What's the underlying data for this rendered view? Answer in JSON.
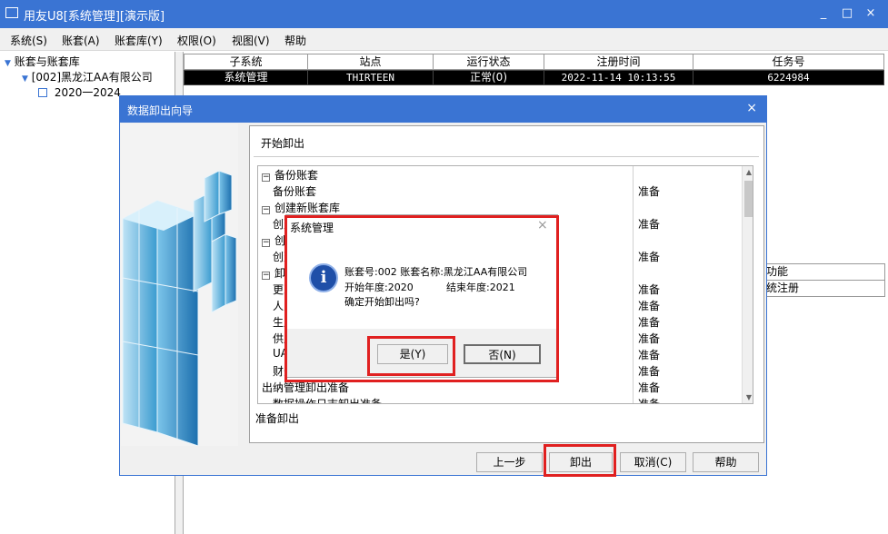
{
  "app": {
    "title": "用友U8[系统管理][演示版]",
    "minimize": "_",
    "maximize": "□",
    "close": "×"
  },
  "menu": [
    {
      "label": "系统(S)"
    },
    {
      "label": "账套(A)"
    },
    {
      "label": "账套库(Y)"
    },
    {
      "label": "权限(O)"
    },
    {
      "label": "视图(V)"
    },
    {
      "label": "帮助"
    }
  ],
  "tree": {
    "root": "账套与账套库",
    "child": "[002]黑龙江AA有限公司",
    "grandchild": "2020一2024"
  },
  "grid": {
    "headers": [
      "子系统",
      "站点",
      "运行状态",
      "注册时间",
      "任务号"
    ],
    "row": [
      "系统管理",
      "THIRTEEN",
      "正常(0)",
      "2022-11-14 10:13:55",
      "6224984"
    ]
  },
  "grid2": {
    "header": "功能",
    "row": "统注册"
  },
  "wizard": {
    "title": "数据卸出向导",
    "close": "×",
    "panel_title": "开始卸出",
    "steps": [
      {
        "label": "备份账套",
        "status": "",
        "group": true,
        "toggle": "−"
      },
      {
        "label": "备份账套",
        "status": "准备",
        "group": false
      },
      {
        "label": "创建新账套库",
        "status": "",
        "group": true,
        "toggle": "−"
      },
      {
        "label": "创建",
        "status": "准备",
        "group": false
      },
      {
        "label": "创建",
        "status": "",
        "group": true,
        "toggle": "−"
      },
      {
        "label": "创建",
        "status": "准备",
        "group": false
      },
      {
        "label": "卸出",
        "status": "",
        "group": true,
        "toggle": "−"
      },
      {
        "label": "更改",
        "status": "准备",
        "group": false
      },
      {
        "label": "人力",
        "status": "准备",
        "group": false
      },
      {
        "label": "生产",
        "status": "准备",
        "group": false
      },
      {
        "label": "供应",
        "status": "准备",
        "group": false
      },
      {
        "label": "UAP",
        "status": "准备",
        "group": false
      },
      {
        "label": "财务",
        "status": "准备",
        "group": false
      },
      {
        "label": "出纳管理卸出准备",
        "status": "准备",
        "group": false
      },
      {
        "label": "数据操作日志卸出准备",
        "status": "准备",
        "group": false
      }
    ],
    "status_text": "准备卸出",
    "buttons": {
      "prev": "上一步",
      "unload": "卸出",
      "cancel": "取消(C)",
      "help": "帮助"
    }
  },
  "msgbox": {
    "title": "系统管理",
    "close": "×",
    "icon": "info-icon",
    "icon_glyph": "i",
    "line1": "账套号:002 账套名称:黑龙江AA有限公司",
    "start_year": "开始年度:2020",
    "end_year": "结束年度:2021",
    "question": "确定开始卸出吗?",
    "yes": "是(Y)",
    "no": "否(N)"
  },
  "colors": {
    "titlebar": "#3a74d3",
    "highlight": "#e02020"
  }
}
